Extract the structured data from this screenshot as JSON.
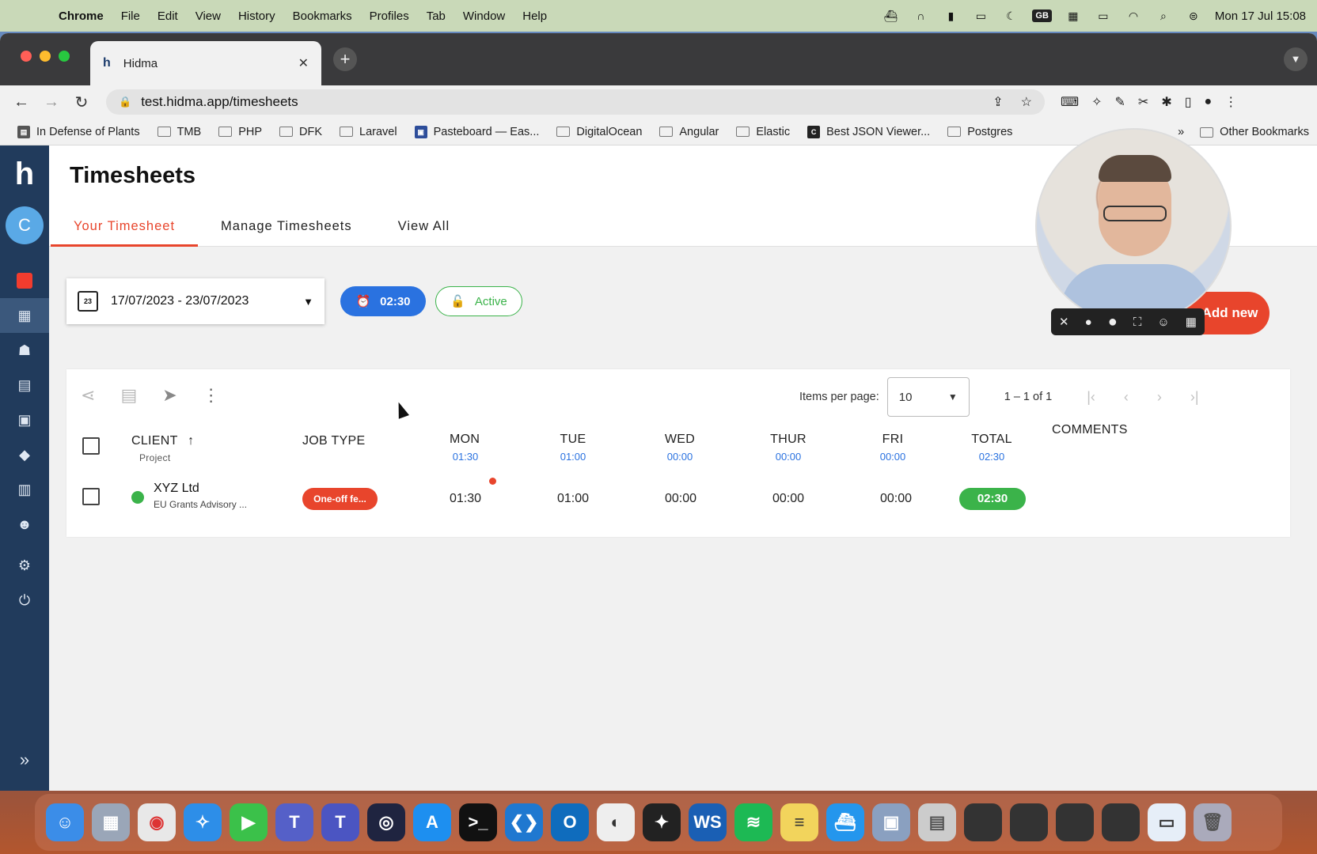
{
  "menubar": {
    "app": "Chrome",
    "items": [
      "File",
      "Edit",
      "View",
      "History",
      "Bookmarks",
      "Profiles",
      "Tab",
      "Window",
      "Help"
    ],
    "input_source": "GB",
    "clock": "Mon 17 Jul  15:08"
  },
  "browser": {
    "tab_title": "Hidma",
    "tab_favicon": "h",
    "url": "test.hidma.app/timesheets",
    "bookmarks": [
      "In Defense of Plants",
      "TMB",
      "PHP",
      "DFK",
      "Laravel",
      "Pasteboard — Eas...",
      "DigitalOcean",
      "Angular",
      "Elastic",
      "Best JSON Viewer...",
      "Postgres"
    ],
    "bookmarks_overflow": "»",
    "other_bookmarks": "Other Bookmarks"
  },
  "sidebar": {
    "logo": "h",
    "avatar_initial": "C",
    "items": [
      "record-icon",
      "timesheet-icon",
      "clients-icon",
      "clipboard-icon",
      "tasks-icon",
      "tag-icon",
      "reports-icon",
      "team-icon",
      "settings-icon",
      "power-icon"
    ],
    "expand": "»"
  },
  "page": {
    "title": "Timesheets",
    "tabs": [
      "Your Timesheet",
      "Manage Timesheets",
      "View All"
    ],
    "active_tab": "Your Timesheet"
  },
  "filters": {
    "date_range": "17/07/2023 - 23/07/2023",
    "calendar_week": "23",
    "timer": "02:30",
    "status": "Active",
    "add_new": "Add new"
  },
  "pager": {
    "items_per_page_label": "Items per page:",
    "items_per_page": "10",
    "range": "1 – 1 of 1"
  },
  "table": {
    "columns": {
      "client": "CLIENT",
      "client_sub": "Project",
      "job_type": "JOB TYPE",
      "mon": "MON",
      "mon_total": "01:30",
      "tue": "TUE",
      "tue_total": "01:00",
      "wed": "WED",
      "wed_total": "00:00",
      "thur": "THUR",
      "thur_total": "00:00",
      "fri": "FRI",
      "fri_total": "00:00",
      "total": "TOTAL",
      "total_total": "02:30",
      "comments": "COMMENTS"
    },
    "rows": [
      {
        "client": "XYZ Ltd",
        "project": "EU Grants Advisory ...",
        "job_type": "One-off fe...",
        "mon": "01:30",
        "tue": "01:00",
        "wed": "00:00",
        "thur": "00:00",
        "fri": "00:00",
        "total": "02:30"
      }
    ]
  },
  "colors": {
    "accent": "#e8452c",
    "primary": "#2a72e0",
    "success": "#3bb34a",
    "sidebar": "#213b5c"
  }
}
